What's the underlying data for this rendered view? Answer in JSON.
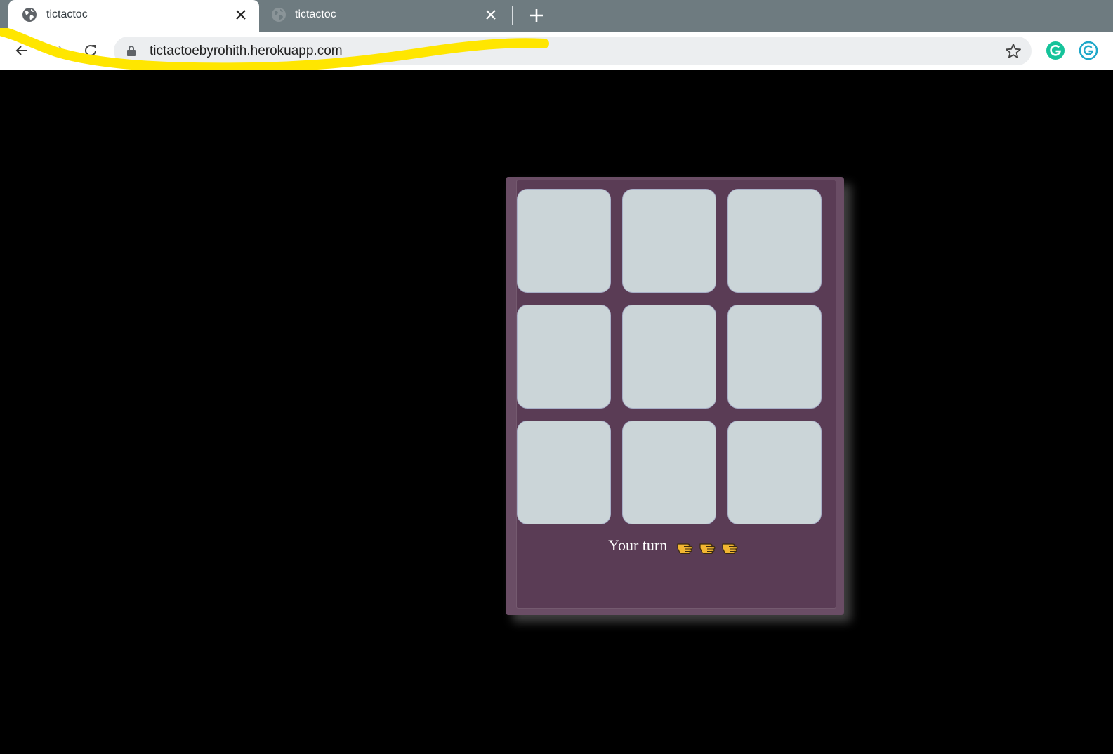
{
  "browser": {
    "tabs": [
      {
        "title": "tictactoc",
        "active": true
      },
      {
        "title": "tictactoc",
        "active": false
      }
    ],
    "url": "tictactoebyrohith.herokuapp.com",
    "extensions": [
      "grammarly-icon",
      "grammarly-icon"
    ]
  },
  "game": {
    "cells": [
      "",
      "",
      "",
      "",
      "",
      "",
      "",
      "",
      ""
    ],
    "status": "Your turn",
    "status_pointer_count": 3
  },
  "colors": {
    "page_background": "#000000",
    "board_background": "#5a3c55",
    "cell_color": "#cbd5d8",
    "highlight_scribble": "#ffe600"
  }
}
